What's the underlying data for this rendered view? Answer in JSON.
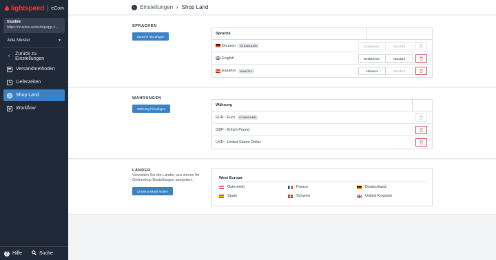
{
  "brand": {
    "name": "lightspeed",
    "product": "eCom"
  },
  "store": {
    "name": "trustee",
    "url": "https://trustee.webshopapp.c..."
  },
  "user": {
    "name": "Julia Meister"
  },
  "nav": {
    "back": "Zurück zu Einstellungen",
    "items": [
      {
        "label": "Versandmethoden",
        "icon": "shipping-icon"
      },
      {
        "label": "Lieferzeiten",
        "icon": "clock-icon"
      },
      {
        "label": "Shop Land",
        "icon": "globe-icon",
        "active": true
      },
      {
        "label": "Workflow",
        "icon": "workflow-icon"
      }
    ],
    "help": "Hilfe",
    "search": "Suche"
  },
  "breadcrumb": {
    "parent": "Einstellungen",
    "current": "Shop Land"
  },
  "languages": {
    "title": "SPRACHEN",
    "add_button": "Sprache hinzufügen",
    "column": "Sprache",
    "rows": [
      {
        "name": "Deutsch",
        "badge": "STANDARD",
        "action1": "Deaktivieren",
        "action2": "Standard",
        "action1_disabled": true,
        "action2_disabled": true,
        "delete_disabled": true
      },
      {
        "name": "English",
        "badge": "",
        "action1": "Deaktivieren",
        "action2": "Standard",
        "action1_disabled": false,
        "action2_disabled": false,
        "delete_disabled": false
      },
      {
        "name": "Español",
        "badge": "INAKTIV",
        "action1": "Aktivieren",
        "action2": "Standard",
        "action1_disabled": false,
        "action2_disabled": true,
        "delete_disabled": false
      }
    ]
  },
  "currencies": {
    "title": "WÄHRUNGEN",
    "add_button": "Währung hinzufügen",
    "column": "Währung",
    "rows": [
      {
        "name": "EUR - Euro",
        "badge": "STANDARD",
        "delete_disabled": true
      },
      {
        "name": "GBP - British Pound",
        "badge": "",
        "delete_disabled": false
      },
      {
        "name": "USD - United States Dollar",
        "badge": "",
        "delete_disabled": false
      }
    ]
  },
  "countries": {
    "title": "LÄNDER",
    "description": "Verwalten Sie die Länder, aus denen Ihr Onlineshop Bestellungen akzeptiert.",
    "button": "Länderauswahl ändern",
    "region": "West Europa",
    "items": [
      "Österreich",
      "France",
      "Deutschland",
      "Spain",
      "Schweiz",
      "United Kingdom"
    ]
  },
  "colors": {
    "accent": "#3b82c4",
    "sidebar": "#1f2937",
    "danger": "#d25757",
    "brand": "#ef3b3b"
  }
}
